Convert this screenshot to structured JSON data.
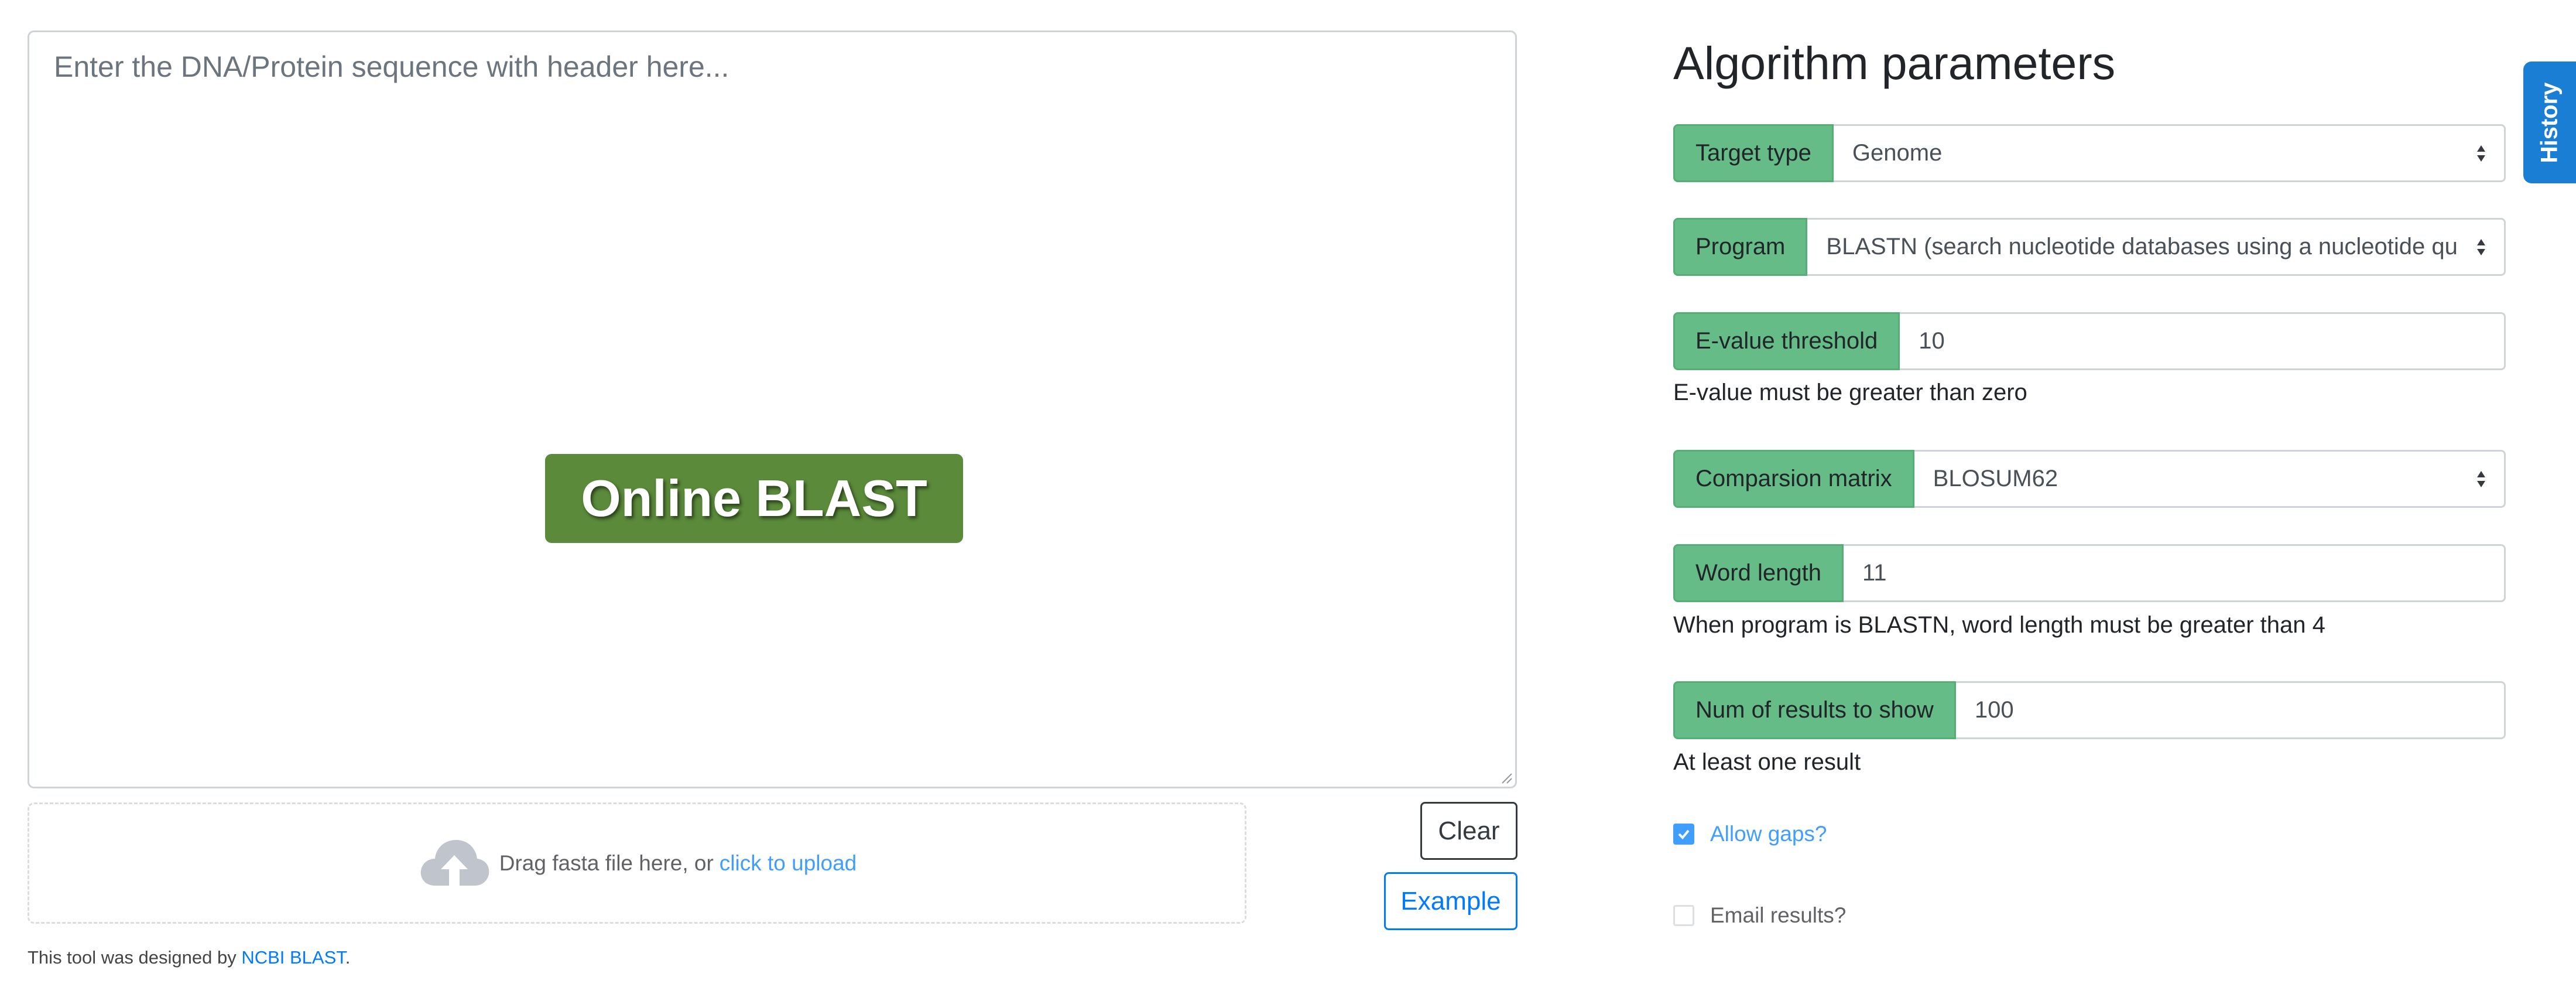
{
  "sequence": {
    "placeholder": "Enter the DNA/Protein sequence with header here...",
    "value": ""
  },
  "badge": {
    "label": "Online BLAST"
  },
  "upload": {
    "text": "Drag fasta file here, or",
    "link": "click to upload",
    "icon": "cloud-upload-icon"
  },
  "buttons": {
    "clear": "Clear",
    "example": "Example"
  },
  "footer": {
    "prefix": "This tool was designed by",
    "link": "NCBI BLAST",
    "suffix": "."
  },
  "params": {
    "title": "Algorithm parameters",
    "target_type": {
      "label": "Target type",
      "value": "Genome"
    },
    "program": {
      "label": "Program",
      "value": "BLASTN (search nucleotide databases using a nucleotide query)"
    },
    "evalue": {
      "label": "E-value threshold",
      "value": "10",
      "help": "E-value must be greater than zero"
    },
    "matrix": {
      "label": "Comparsion matrix",
      "value": "BLOSUM62"
    },
    "word_length": {
      "label": "Word length",
      "value": "11",
      "help": "When program is BLASTN, word length must be greater than 4"
    },
    "num_results": {
      "label": "Num of results to show",
      "value": "100",
      "help": "At least one result"
    },
    "allow_gaps": {
      "label": "Allow gaps?",
      "checked": true
    },
    "email_results": {
      "label": "Email results?",
      "checked": false
    }
  },
  "history": {
    "label": "History"
  },
  "colors": {
    "label_green": "#65bc86",
    "badge_green": "#5a8a3a",
    "primary_blue": "#007bff",
    "element_blue": "#409eff",
    "history_blue": "#1a7fd4"
  }
}
